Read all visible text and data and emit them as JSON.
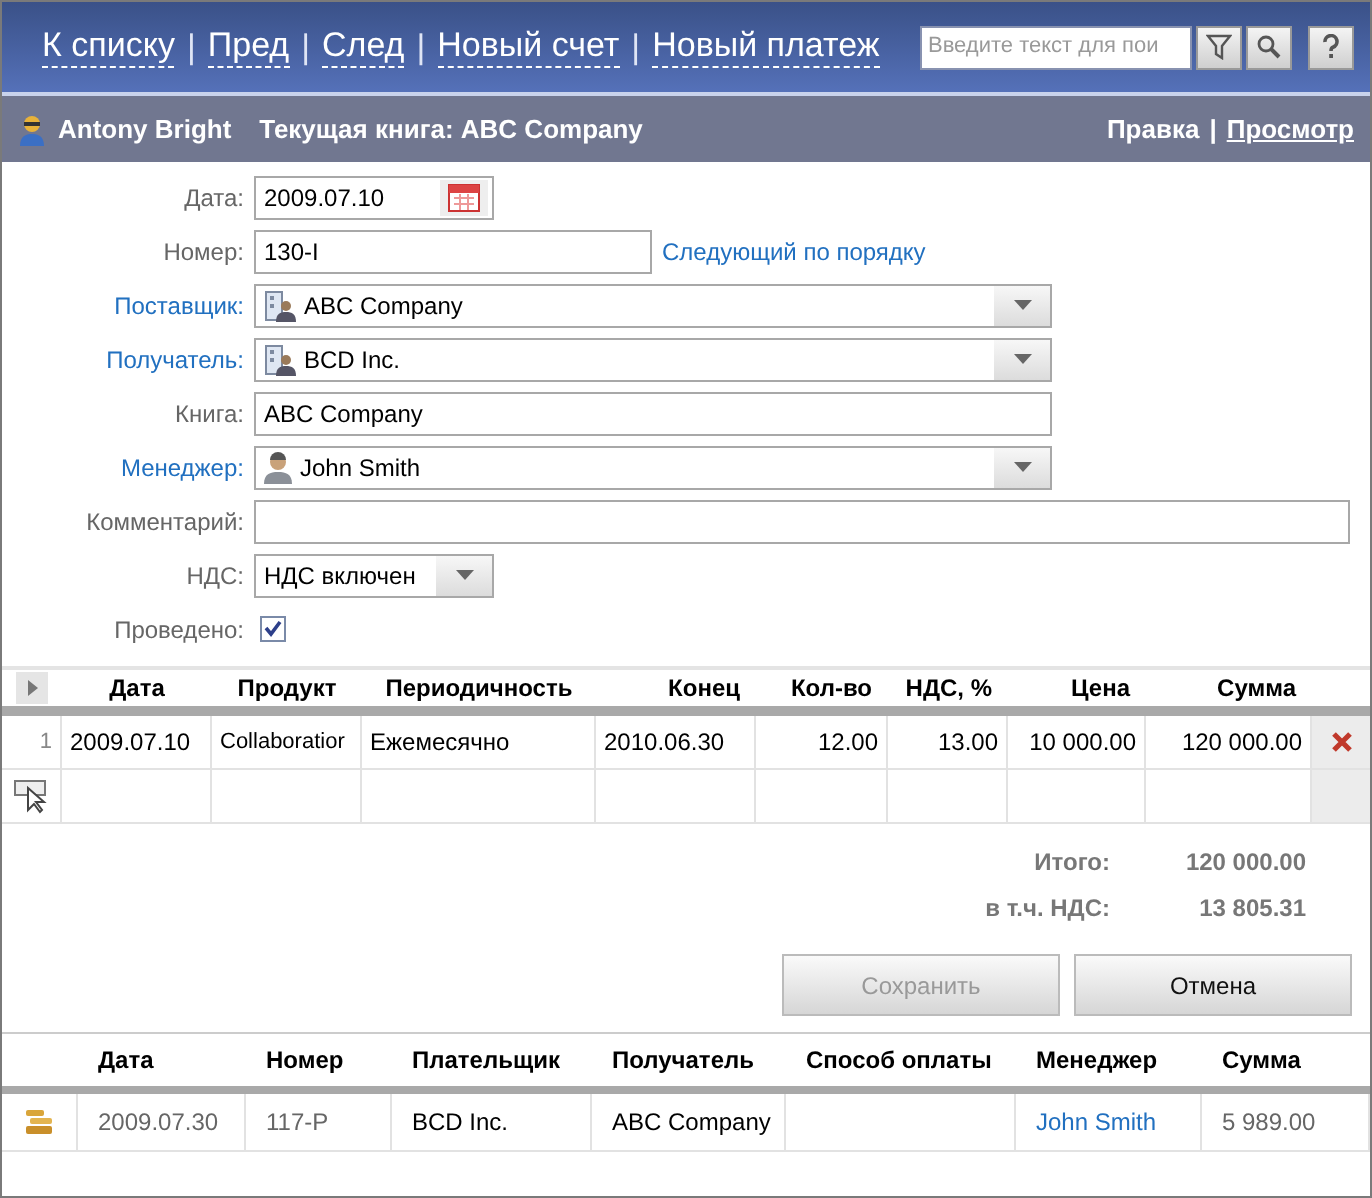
{
  "nav": {
    "items": [
      {
        "kind": "link",
        "label": "К списку"
      },
      {
        "kind": "separator",
        "label": "|"
      },
      {
        "kind": "link",
        "label": "Пред"
      },
      {
        "kind": "separator",
        "label": "|"
      },
      {
        "kind": "link",
        "label": "След"
      },
      {
        "kind": "separator",
        "label": "|"
      },
      {
        "kind": "link",
        "label": "Новый счет"
      },
      {
        "kind": "separator",
        "label": "|"
      },
      {
        "kind": "link",
        "label": "Новый платеж"
      }
    ],
    "search": {
      "placeholder": "Введите текст для пои"
    }
  },
  "subbar": {
    "user": "Antony Bright",
    "book": "Текущая книга: ABC Company",
    "modes": [
      {
        "label": "Правка",
        "selected": true
      },
      {
        "label": "Просмотр",
        "selected": false
      }
    ],
    "mode_separator": "|"
  },
  "form": [
    {
      "kind": "date",
      "label": "Дата:",
      "is_link": false,
      "value": "2009.07.10"
    },
    {
      "kind": "number",
      "label": "Номер:",
      "is_link": false,
      "value": "130-I",
      "link": "Следующий по порядку"
    },
    {
      "kind": "company_lookup",
      "label": "Поставщик:",
      "is_link": true,
      "value": "ABC Company"
    },
    {
      "kind": "company_lookup",
      "label": "Получатель:",
      "is_link": true,
      "value": "BCD Inc."
    },
    {
      "kind": "text",
      "label": "Книга:",
      "is_link": false,
      "value": "ABC Company"
    },
    {
      "kind": "person_lookup",
      "label": "Менеджер:",
      "is_link": true,
      "value": "John Smith"
    },
    {
      "kind": "comment",
      "label": "Комментарий:",
      "is_link": false
    },
    {
      "kind": "select",
      "label": "НДС:",
      "is_link": false,
      "value": "НДС включен"
    },
    {
      "kind": "checkbox",
      "label": "Проведено:",
      "is_link": false,
      "checked": true
    }
  ],
  "lines": {
    "columns": [
      "Дата",
      "Продукт",
      "Периодичность",
      "Конец",
      "Кол-во",
      "НДС, %",
      "Цена",
      "Сумма"
    ],
    "rows": [
      {
        "number": "1",
        "cells": [
          "2009.07.10",
          "Collaboratior",
          "Ежемесячно",
          "2010.06.30",
          "12.00",
          "13.00",
          "10 000.00",
          "120 000.00"
        ]
      }
    ]
  },
  "totals": [
    {
      "label": "Итого:",
      "value": "120 000.00"
    },
    {
      "label": "в т.ч. НДС:",
      "value": "13 805.31"
    }
  ],
  "buttons": [
    {
      "label": "Сохранить",
      "disabled": true
    },
    {
      "label": "Отмена",
      "disabled": false
    }
  ],
  "payments": {
    "columns": [
      "Дата",
      "Номер",
      "Плательщик",
      "Получатель",
      "Способ оплаты",
      "Менеджер",
      "Сумма"
    ],
    "rows": [
      {
        "date": "2009.07.30",
        "number": "117-P",
        "payer": "BCD Inc.",
        "recipient": "ABC Company",
        "manager": "John Smith",
        "amount": "5 989.00"
      }
    ]
  }
}
